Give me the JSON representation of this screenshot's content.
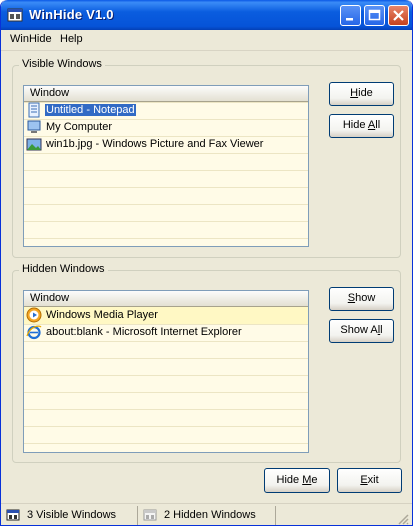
{
  "window": {
    "title": "WinHide V1.0"
  },
  "menu": {
    "items": [
      "WinHide",
      "Help"
    ]
  },
  "visible": {
    "group_label": "Visible Windows",
    "column_header": "Window",
    "items": [
      {
        "label": "Untitled - Notepad",
        "icon": "notepad-icon",
        "selected": true
      },
      {
        "label": "My Computer",
        "icon": "computer-icon",
        "selected": false
      },
      {
        "label": "win1b.jpg - Windows Picture and Fax Viewer",
        "icon": "picture-icon",
        "selected": false
      }
    ],
    "hide_pre": "",
    "hide_u": "H",
    "hide_post": "ide",
    "hideall_pre": "Hide ",
    "hideall_u": "A",
    "hideall_post": "ll"
  },
  "hidden": {
    "group_label": "Hidden Windows",
    "column_header": "Window",
    "items": [
      {
        "label": "Windows Media Player",
        "icon": "media-player-icon"
      },
      {
        "label": "about:blank - Microsoft Internet Explorer",
        "icon": "ie-icon"
      }
    ],
    "show_pre": "",
    "show_u": "S",
    "show_post": "how",
    "showall_pre": "Show A",
    "showall_u": "l",
    "showall_post": "l"
  },
  "footer": {
    "hideme_pre": "Hide ",
    "hideme_u": "M",
    "hideme_post": "e",
    "exit_pre": "",
    "exit_u": "E",
    "exit_post": "xit"
  },
  "status": {
    "visible_text": "3 Visible Windows",
    "hidden_text": "2 Hidden Windows"
  },
  "colors": {
    "titlebar": "#0a5ddf",
    "selection": "#316ac5",
    "list_bg": "#fffbe7",
    "window_bg": "#ece9d8"
  }
}
